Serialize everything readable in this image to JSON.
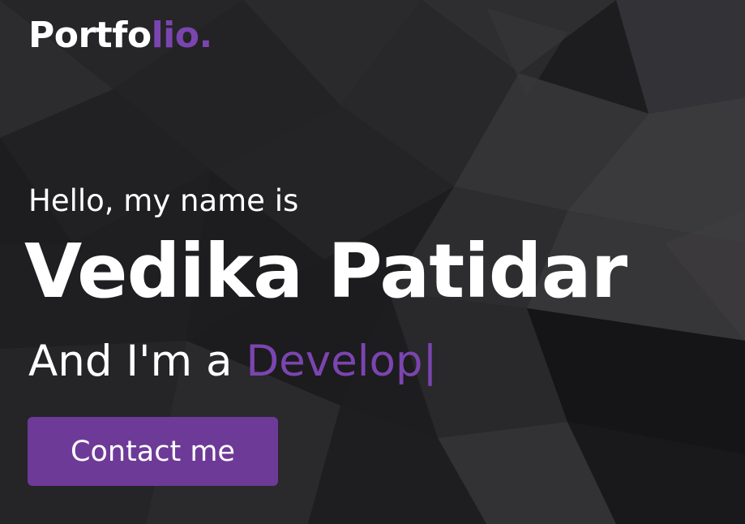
{
  "header": {
    "logo_main": "Portfo",
    "logo_accent": "lio."
  },
  "hero": {
    "greeting": "Hello, my name is",
    "name": "Vedika Patidar",
    "role_prefix": "And I'm a ",
    "role_typed": "Develop",
    "cursor": "|",
    "contact_button": "Contact me"
  },
  "colors": {
    "accent": "#7b45b0",
    "button": "#6e3a98",
    "background": "#1d1c1f",
    "text": "#ffffff"
  }
}
